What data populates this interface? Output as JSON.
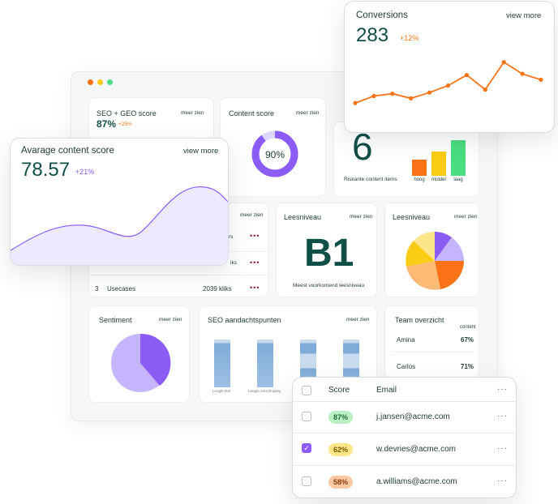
{
  "colors": {
    "accent_teal": "#0f4f46",
    "purple": "#8b5cf6",
    "orange": "#f97316",
    "yellow": "#facc15",
    "green": "#4ade80",
    "dot_red": "#8b1a2e"
  },
  "conversions": {
    "title": "Conversions",
    "more": "view more",
    "value": "283",
    "delta": "+12%",
    "line": [
      0.22,
      0.34,
      0.38,
      0.3,
      0.4,
      0.52,
      0.7,
      0.45,
      0.92,
      0.72,
      0.62
    ]
  },
  "avg": {
    "title": "Avarage content score",
    "more": "view more",
    "value": "78.57",
    "delta": "+21%"
  },
  "seo_geo": {
    "title": "SEO + GEO score",
    "more": "meer zien",
    "value": "87%",
    "delta": "+25%"
  },
  "content_score": {
    "title": "Content score",
    "more": "meer zien",
    "value": "90%",
    "percent": 90
  },
  "risk": {
    "value": "6",
    "label": "Riskante content items",
    "bars": [
      {
        "label": "hoog",
        "value": 0.45,
        "color": "#f97316"
      },
      {
        "label": "middel",
        "value": 0.68,
        "color": "#facc15"
      },
      {
        "label": "laag",
        "value": 1.0,
        "color": "#4ade80"
      }
    ]
  },
  "usecases": {
    "more": "meer zien",
    "rows": [
      {
        "n": "",
        "name": "",
        "value": "rs"
      },
      {
        "n": "",
        "name": "",
        "value": "iks"
      },
      {
        "n": "3",
        "name": "Usecases",
        "value": "2039 kliks"
      }
    ]
  },
  "lees1": {
    "title": "Leesniveau",
    "more": "meer zien",
    "value": "B1",
    "label": "Meest voorkomend leesniveau"
  },
  "lees2": {
    "title": "Leesniveau",
    "more": "meer zien"
  },
  "sentiment": {
    "title": "Sentiment",
    "more": "meer zien"
  },
  "seo_points": {
    "title": "SEO aandachtspunten",
    "more": "meer zien",
    "bars": [
      0.95,
      0.95,
      0.95,
      0.95
    ],
    "labels": [
      "Lengte titel",
      "Lengte omschrijving",
      "",
      ""
    ]
  },
  "team": {
    "title": "Team overzicht",
    "col": "content",
    "rows": [
      {
        "name": "Amina",
        "value": "67%"
      },
      {
        "name": "Carlos",
        "value": "71%"
      }
    ]
  },
  "table": {
    "headers": {
      "score": "Score",
      "email": "Email"
    },
    "rows": [
      {
        "score": "87%",
        "email": "j.jansen@acme.com",
        "checked": false,
        "color": "#bbf0c7",
        "text": "#1f6b3a"
      },
      {
        "score": "62%",
        "email": "w.devries@acme.com",
        "checked": true,
        "color": "#fde68a",
        "text": "#7a5a00"
      },
      {
        "score": "58%",
        "email": "a.williams@acme.com",
        "checked": false,
        "color": "#fdc8a4",
        "text": "#8a3b0a"
      }
    ]
  }
}
